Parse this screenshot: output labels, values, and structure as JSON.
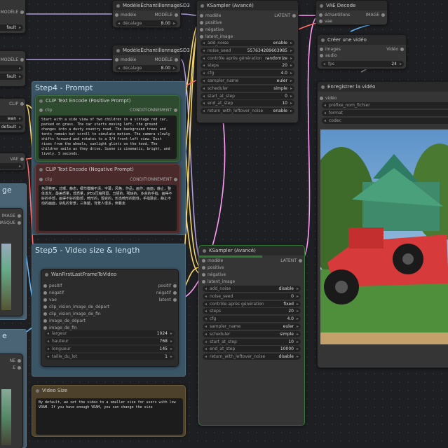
{
  "colors": {
    "clip": "#f6d66a",
    "model": "#b19cd9",
    "latent": "#ff9cf9",
    "vae": "#ff6e6e",
    "image": "#64b5f6",
    "float": "#aaa",
    "accent": "#4caf50"
  },
  "sampling1": {
    "title": "ModèleÉchantillonnageSD3",
    "in": "modèle",
    "out": "MODÈLE",
    "wlabel": "décalage",
    "wval": "8.00"
  },
  "sampling2": {
    "title": "ModèleÉchantillonnageSD3",
    "in": "modèle",
    "out": "MODÈLE",
    "wlabel": "décalage",
    "wval": "8.00"
  },
  "left": {
    "out_model": "MODÈLE",
    "fault1": "fault",
    "out_model2": "MODÈLE",
    "fault2": "fault",
    "clip": "CLIP",
    "wan": "wan",
    "default": "default",
    "vae": "VAE",
    "age": "ge",
    "image": "IMAGE",
    "masque": "MASQUE",
    "e": "e",
    "ne": "NE",
    "e2": "E"
  },
  "ksampler1": {
    "title": "KSampler (Avancé)",
    "inputs": [
      "modèle",
      "positive",
      "négative",
      "latent_image"
    ],
    "out": "LATENT",
    "widgets": [
      [
        "add_noise",
        "enable"
      ],
      [
        "noise_seed",
        "557634289603985"
      ],
      [
        "contrôle après génération",
        "randomize"
      ],
      [
        "steps",
        "20"
      ],
      [
        "cfg",
        "4.0"
      ],
      [
        "sampler_name",
        "euler"
      ],
      [
        "scheduler",
        "simple"
      ],
      [
        "start_at_step",
        "0"
      ],
      [
        "end_at_step",
        "10"
      ],
      [
        "return_with_leftover_noise",
        "enable"
      ]
    ]
  },
  "ksampler2": {
    "title": "KSampler (Avancé)",
    "inputs": [
      "modèle",
      "positive",
      "négative",
      "latent_image"
    ],
    "out": "LATENT",
    "widgets": [
      [
        "add_noise",
        "disable"
      ],
      [
        "noise_seed",
        "0"
      ],
      [
        "contrôle après génération",
        "fixed"
      ],
      [
        "steps",
        "20"
      ],
      [
        "cfg",
        "4.0"
      ],
      [
        "sampler_name",
        "euler"
      ],
      [
        "scheduler",
        "simple"
      ],
      [
        "start_at_step",
        "10"
      ],
      [
        "end_at_step",
        "10000"
      ],
      [
        "return_with_leftover_noise",
        "disable"
      ]
    ]
  },
  "vaedecode": {
    "title": "VAE Decode",
    "in1": "échantillons",
    "in2": "vae",
    "out": "IMAGE"
  },
  "createvideo": {
    "title": "Créer une vidéo",
    "in1": "images",
    "in2": "audio",
    "out": "Vidéo",
    "wlabel": "fps",
    "wval": "24"
  },
  "savevideo": {
    "title": "Enregistrer la vidéo",
    "in": "vidéo",
    "w1": "préfixe_nom_fichier",
    "w2": "format",
    "w3": "codec"
  },
  "step4": {
    "title": "Step4 - Prompt"
  },
  "step5": {
    "title": "Step5 - Video size & length"
  },
  "clippos": {
    "title": "CLIP Text Encode (Positive Prompt)",
    "in": "clip",
    "out": "CONDITIONNEMENT",
    "text": "Start with a side view of two children in a vintage red car, parked on grass. The car starts moving left, the ground changes into a dusty country road. The background trees and tents remain but scroll to simulate motion. The camera slowly shifts forward and rotates to a 3/4 front-left view. Dust rises from the wheels, sunlight glints on the hood. The children smile as they drive. Scene is cinematic, bright, and lively. 5 seconds."
  },
  "clipneg": {
    "title": "CLIP Text Encode (Negative Prompt)",
    "in": "clip",
    "out": "CONDITIONNEMENT",
    "text": "色调艳丽，过曝，静态，细节模糊不清，字幕，风格，作品，画作，画面，静止，整体发灰，最差质量，低质量，JPEG压缩残留，丑陋的，残缺的，多余的手指，画得不好的手部，画得不好的脸部，畸形的，毁容的，形态畸形的肢体，手指融合，静止不动的画面，杂乱的背景，三条腿，背景人很多，倒着走"
  },
  "wan": {
    "title": "WanFirstLastFrameToVideo",
    "ins": [
      "positif",
      "négatif",
      "vae",
      "clip_vision_image_de_départ",
      "clip_vision_image_de_fin",
      "image_de_départ",
      "image_de_fin"
    ],
    "outs": [
      "positif",
      "négatif",
      "latent"
    ],
    "widgets": [
      [
        "largeur",
        "1024"
      ],
      [
        "hauteur",
        "768"
      ],
      [
        "longueur",
        "145"
      ],
      [
        "taille_du_lot",
        "1"
      ]
    ]
  },
  "note": {
    "title": "Video Size",
    "text": "By default, we set the video to a smaller size for users with low VRAM. If you have enough VRAM, you can change the size"
  }
}
